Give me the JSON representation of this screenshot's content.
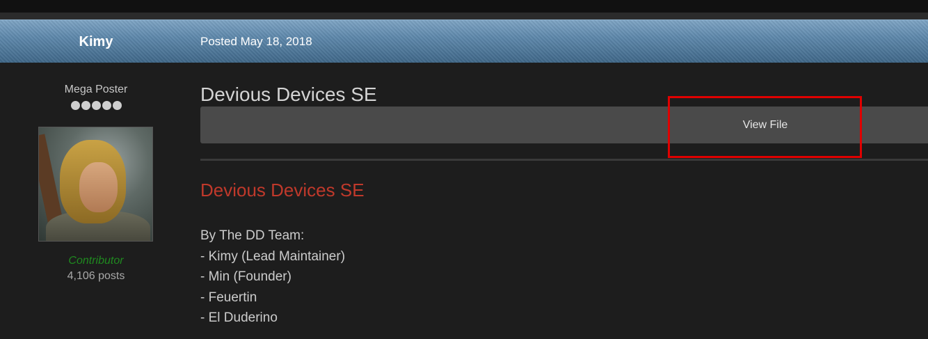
{
  "post": {
    "author": "Kimy",
    "date": "Posted May 18, 2018"
  },
  "author_panel": {
    "title": "Mega Poster",
    "rank_pips": 5,
    "group": "Contributor",
    "posts": "4,106 posts"
  },
  "content": {
    "file_title": "Devious Devices SE",
    "view_file_label": "View File",
    "heading": "Devious Devices SE",
    "credits": [
      "By The DD Team:",
      "- Kimy (Lead Maintainer)",
      "- Min (Founder)",
      "- Feuertin",
      "- El Duderino"
    ]
  },
  "colors": {
    "header": "#5e88ab",
    "heading_red": "#c0392b",
    "group_green": "#1f8a1f",
    "highlight": "#e00000"
  }
}
